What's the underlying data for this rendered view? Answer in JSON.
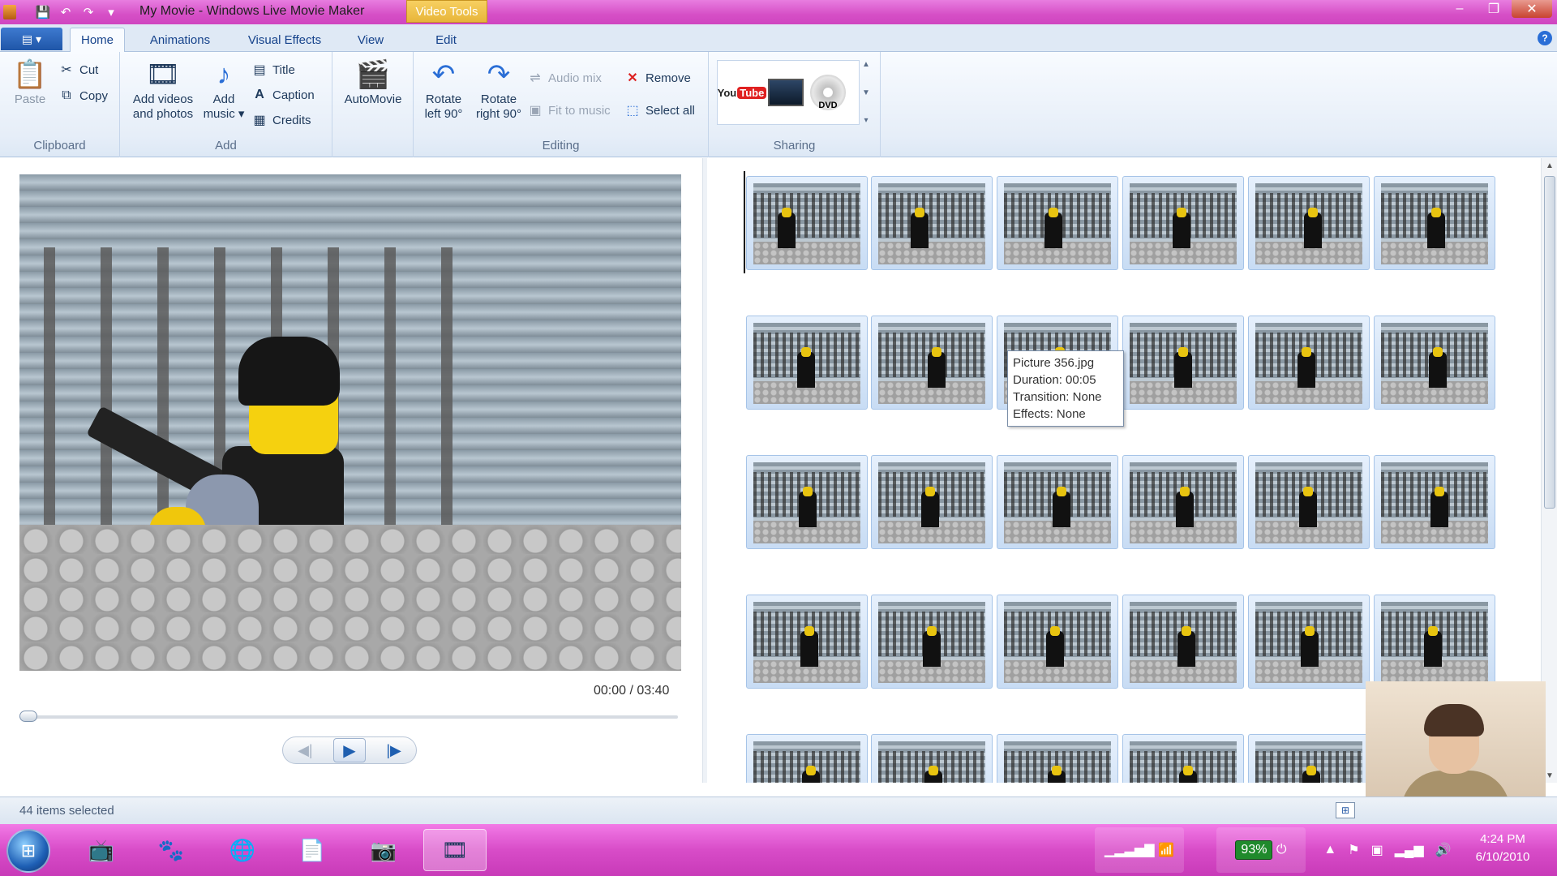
{
  "window": {
    "title": "My Movie - Windows Live Movie Maker",
    "context_tab": "Video Tools",
    "controls": {
      "minimize": "‒",
      "maximize": "❐",
      "close": "✕"
    }
  },
  "quick_access": {
    "save": "💾",
    "undo": "↶",
    "redo": "↷",
    "customize": "▾"
  },
  "tabs": {
    "menu": "▤ ▾",
    "items": [
      "Home",
      "Animations",
      "Visual Effects",
      "View",
      "Edit"
    ],
    "help": "?"
  },
  "ribbon": {
    "clipboard": {
      "label": "Clipboard",
      "paste": "Paste",
      "cut": "Cut",
      "copy": "Copy"
    },
    "add": {
      "label": "Add",
      "add_videos_line1": "Add videos",
      "add_videos_line2": "and photos",
      "add_music_line1": "Add",
      "add_music_line2": "music ▾",
      "title": "Title",
      "caption": "Caption",
      "credits": "Credits"
    },
    "automovie": "AutoMovie",
    "editing": {
      "label": "Editing",
      "rotate_left_line1": "Rotate",
      "rotate_left_line2": "left 90°",
      "rotate_right_line1": "Rotate",
      "rotate_right_line2": "right 90°",
      "audio_mix": "Audio mix",
      "fit_to_music": "Fit to music",
      "remove": "Remove",
      "select_all": "Select all"
    },
    "sharing": {
      "label": "Sharing",
      "youtube_a": "You",
      "youtube_b": "Tube",
      "dvd": "DVD"
    }
  },
  "preview": {
    "timecode": "00:00 / 03:40",
    "progress": 0,
    "prev_frame": "◀|",
    "play": "▶",
    "next_frame": "|▶"
  },
  "storyboard": {
    "tooltip": {
      "name": "Picture 356.jpg",
      "duration": "Duration: 00:05",
      "transition": "Transition: None",
      "effects": "Effects: None"
    }
  },
  "status": {
    "selection": "44 items selected"
  },
  "taskbar": {
    "battery": "93%",
    "time": "4:24 PM",
    "date": "6/10/2010"
  }
}
